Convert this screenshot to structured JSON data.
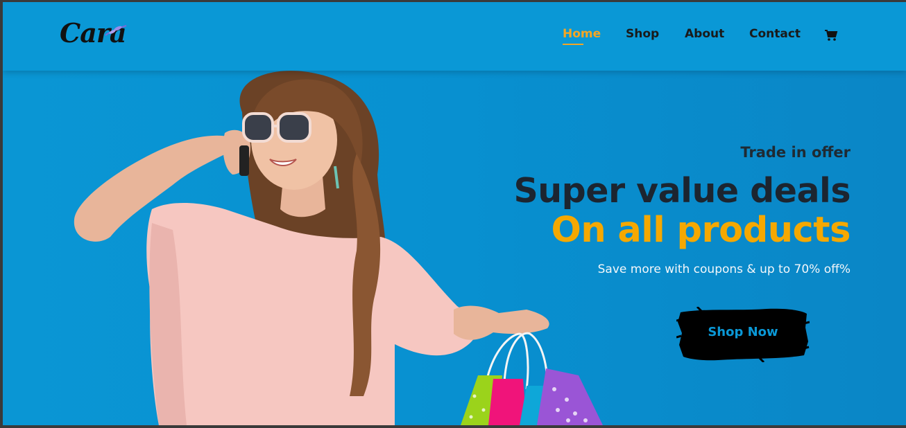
{
  "brand": {
    "name": "Cara"
  },
  "nav": {
    "items": [
      {
        "label": "Home",
        "active": true
      },
      {
        "label": "Shop",
        "active": false
      },
      {
        "label": "About",
        "active": false
      },
      {
        "label": "Contact",
        "active": false
      }
    ],
    "cart_icon": "shopping-cart-icon"
  },
  "hero": {
    "kicker": "Trade in offer",
    "headline": "Super value deals",
    "headline_highlight": "On all products",
    "subtext": "Save more with coupons & up to 70% off%",
    "cta_label": "Shop Now",
    "image": "woman-with-shopping-bags"
  },
  "colors": {
    "background": "#0a98d6",
    "accent": "#f5a800",
    "text_dark": "#1c2530",
    "button_bg": "#000000",
    "button_text": "#0a98d6"
  }
}
